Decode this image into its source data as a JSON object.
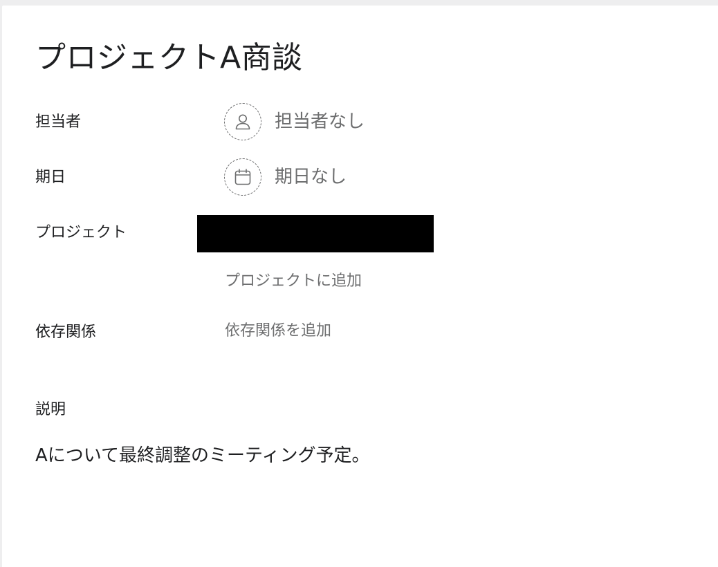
{
  "task": {
    "title": "プロジェクトA商談"
  },
  "fields": {
    "assignee": {
      "label": "担当者",
      "value": "担当者なし",
      "icon": "user-icon"
    },
    "due_date": {
      "label": "期日",
      "value": "期日なし",
      "icon": "calendar-icon"
    },
    "project": {
      "label": "プロジェクト",
      "add_label": "プロジェクトに追加"
    },
    "dependencies": {
      "label": "依存関係",
      "add_label": "依存関係を追加"
    }
  },
  "description": {
    "label": "説明",
    "text": "Aについて最終調整のミーティング予定。"
  },
  "colors": {
    "text_primary": "#1e1f21",
    "text_secondary": "#6d6e6f",
    "background": "#ffffff",
    "redaction": "#000000"
  }
}
